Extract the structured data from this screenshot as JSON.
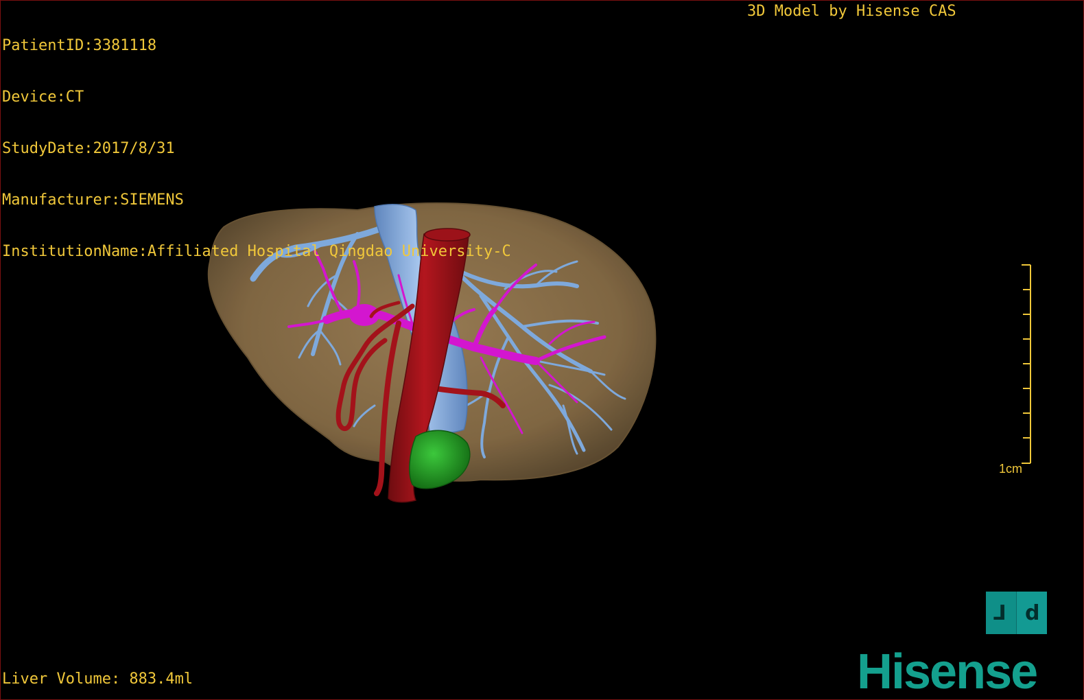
{
  "patient": {
    "id_line": "PatientID:3381118",
    "device_line": "Device:CT",
    "study_date_line": "StudyDate:2017/8/31",
    "manufacturer_line": "Manufacturer:SIEMENS",
    "institution_line": "InstitutionName:Affiliated Hospital Qingdao University-C"
  },
  "header": {
    "model_credit": "3D Model by Hisense CAS"
  },
  "footer": {
    "liver_volume": "Liver Volume: 883.4ml"
  },
  "scale_bar": {
    "label": "1cm"
  },
  "orientation": {
    "left_glyph": "L",
    "right_glyph": "P"
  },
  "branding": {
    "logo_text": "Hisense"
  },
  "colors": {
    "overlay_text": "#f1c83a",
    "liver": "#8a7048",
    "hepatic_vein": "#7ea9dc",
    "portal_vein": "#d316cf",
    "artery_ivc": "#a3121a",
    "gallbladder": "#1f9c1f",
    "brand": "#14a08e"
  }
}
